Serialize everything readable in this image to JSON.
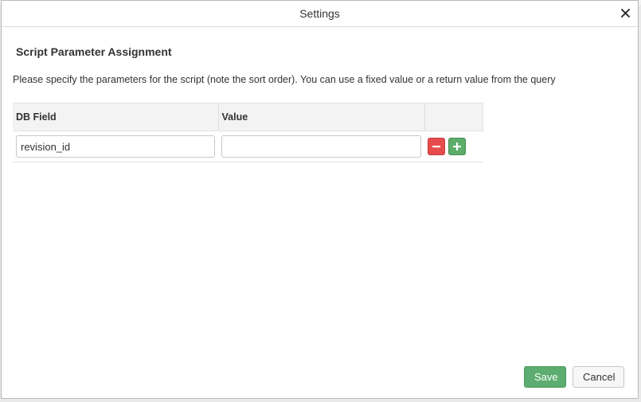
{
  "dialog": {
    "title": "Settings",
    "close_icon": "close-icon",
    "section_title": "Script Parameter Assignment",
    "description": "Please specify the parameters for the script (note the sort order). You can use a fixed value or a return value from the query"
  },
  "table": {
    "columns": [
      "DB Field",
      "Value",
      ""
    ],
    "rows": [
      {
        "db_field": "revision_id",
        "value": ""
      }
    ],
    "row_actions": {
      "remove_icon": "minus-icon",
      "add_icon": "plus-icon"
    }
  },
  "footer": {
    "save_label": "Save",
    "cancel_label": "Cancel"
  },
  "colors": {
    "save": "#5cad6f",
    "remove": "#e74c4c",
    "add": "#5cad6a"
  }
}
